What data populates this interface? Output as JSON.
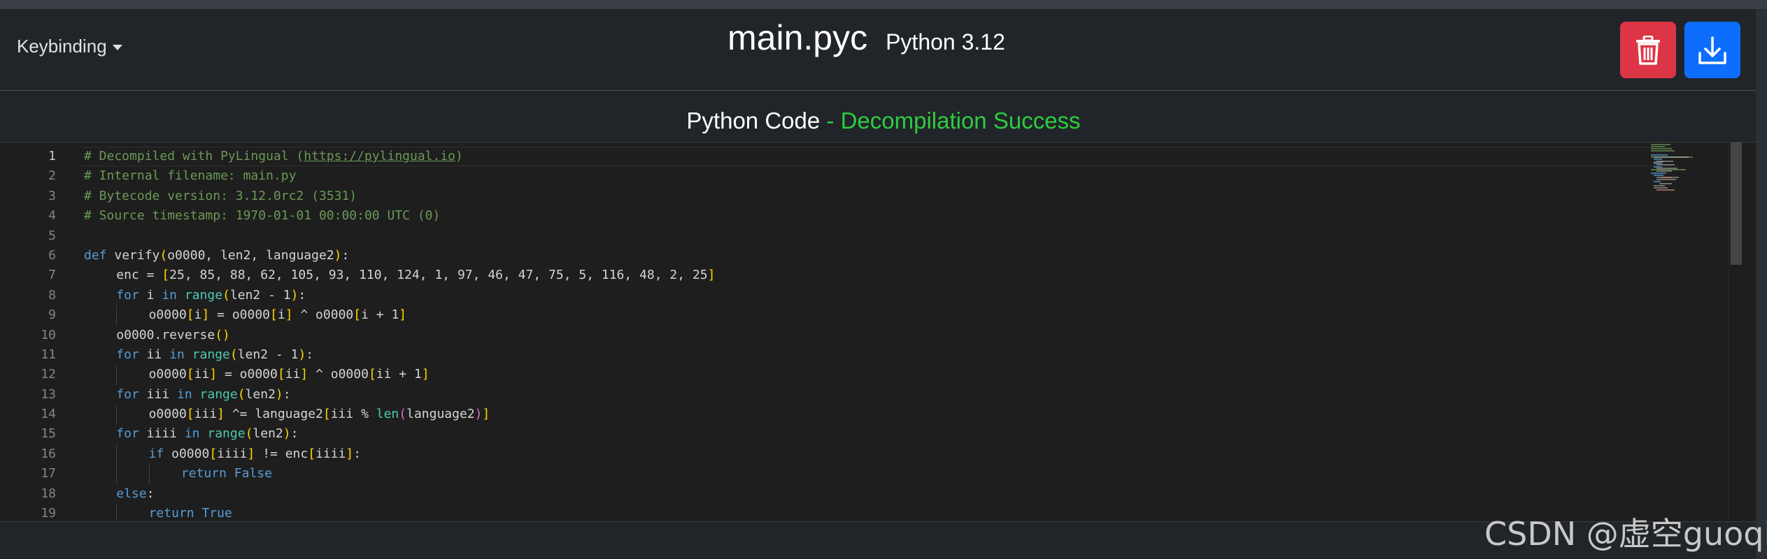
{
  "header": {
    "keybinding_label": "Keybinding",
    "filename": "main.pyc",
    "python_version": "Python 3.12",
    "delete_button_icon": "trash-icon",
    "download_button_icon": "download-icon",
    "delete_color": "#dc3545",
    "download_color": "#0d6efd"
  },
  "subheader": {
    "code_label": "Python Code",
    "separator": " - ",
    "status": "Decompilation Success",
    "status_color": "#2ecc40"
  },
  "editor": {
    "active_line": 1,
    "line_numbers": [
      "1",
      "2",
      "3",
      "4",
      "5",
      "6",
      "7",
      "8",
      "9",
      "10",
      "11",
      "12",
      "13",
      "14",
      "15",
      "16",
      "17",
      "18",
      "19"
    ],
    "lines": [
      "# Decompiled with PyLingual (https://pylingual.io)",
      "# Internal filename: main.py",
      "# Bytecode version: 3.12.0rc2 (3531)",
      "# Source timestamp: 1970-01-01 00:00:00 UTC (0)",
      "",
      "def verify(o0000, len2, language2):",
      "    enc = [25, 85, 88, 62, 105, 93, 110, 124, 1, 97, 46, 47, 75, 5, 116, 48, 2, 25]",
      "    for i in range(len2 - 1):",
      "        o0000[i] = o0000[i] ^ o0000[i + 1]",
      "    o0000.reverse()",
      "    for ii in range(len2 - 1):",
      "        o0000[ii] = o0000[ii] ^ o0000[ii + 1]",
      "    for iii in range(len2):",
      "        o0000[iii] ^= language2[iii % len(language2)]",
      "    for iiii in range(len2):",
      "        if o0000[iiii] != enc[iiii]:",
      "            return False",
      "    else:",
      "        return True"
    ]
  },
  "watermark": "CSDN @虚空guoql"
}
